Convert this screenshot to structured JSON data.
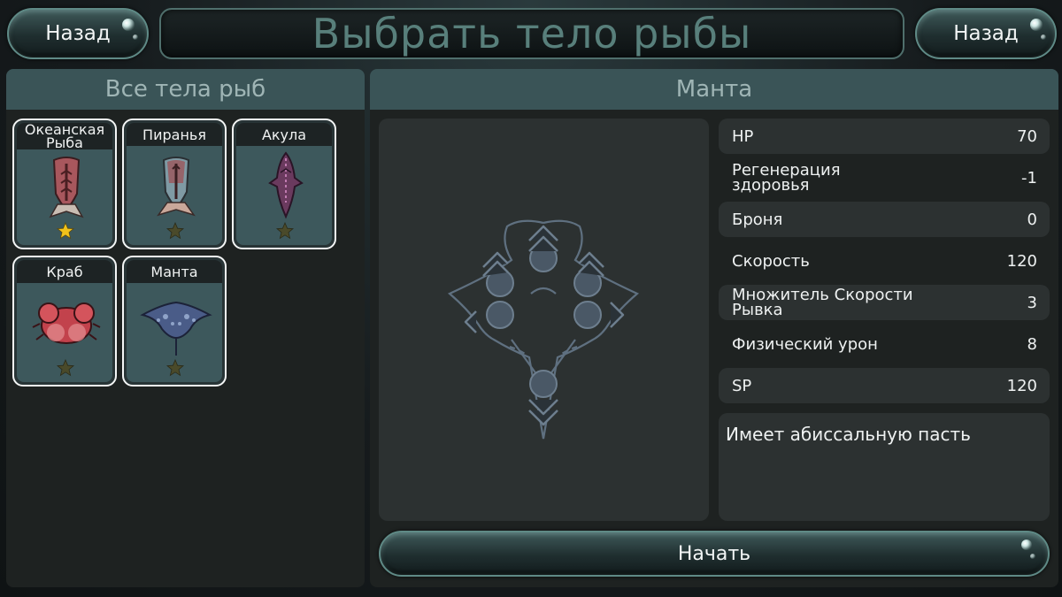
{
  "header": {
    "back_left_label": "Назад",
    "back_right_label": "Назад",
    "title": "Выбрать тело рыбы"
  },
  "left_panel": {
    "title": "Все тела рыб",
    "cards": [
      {
        "label": "Океанская Рыба",
        "icon": "ocean-fish-icon",
        "star": "gold"
      },
      {
        "label": "Пиранья",
        "icon": "piranha-icon",
        "star": "dark"
      },
      {
        "label": "Акула",
        "icon": "shark-icon",
        "star": "dark"
      },
      {
        "label": "Краб",
        "icon": "crab-icon",
        "star": "dark"
      },
      {
        "label": "Манта",
        "icon": "manta-icon",
        "star": "dark"
      }
    ]
  },
  "right_panel": {
    "title": "Манта",
    "stats": [
      {
        "name": "HP",
        "value": "70"
      },
      {
        "name": "Регенерация здоровья",
        "value": "-1"
      },
      {
        "name": "Броня",
        "value": "0"
      },
      {
        "name": "Скорость",
        "value": "120"
      },
      {
        "name": "Множитель Скорости Рывка",
        "value": "3"
      },
      {
        "name": "Физический урон",
        "value": "8"
      },
      {
        "name": "SP",
        "value": "120"
      }
    ],
    "description": "Имеет абиссальную пасть",
    "start_label": "Начать"
  },
  "colors": {
    "header_panel": "#3a5457",
    "title_text": "#587f7b",
    "star_gold": "#f1c21b",
    "star_dark": "#4a4a2a"
  }
}
